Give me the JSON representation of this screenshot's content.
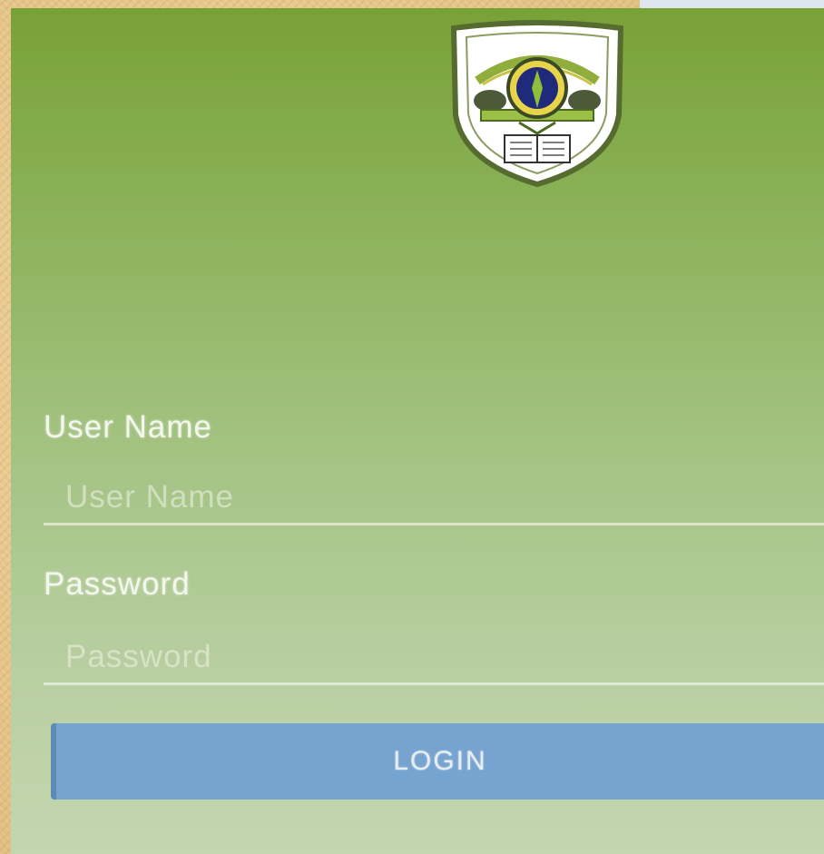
{
  "login_form": {
    "username_label": "User Name",
    "username_placeholder": "User Name",
    "username_value": "",
    "password_label": "Password",
    "password_placeholder": "Password",
    "password_value": "",
    "login_button_label": "LOGIN"
  },
  "logo": {
    "icon": "school-crest-shield"
  },
  "colors": {
    "background_top": "#78a236",
    "background_bottom": "#c3d6ae",
    "button": "#76a3cf",
    "frame": "#e6c488"
  }
}
